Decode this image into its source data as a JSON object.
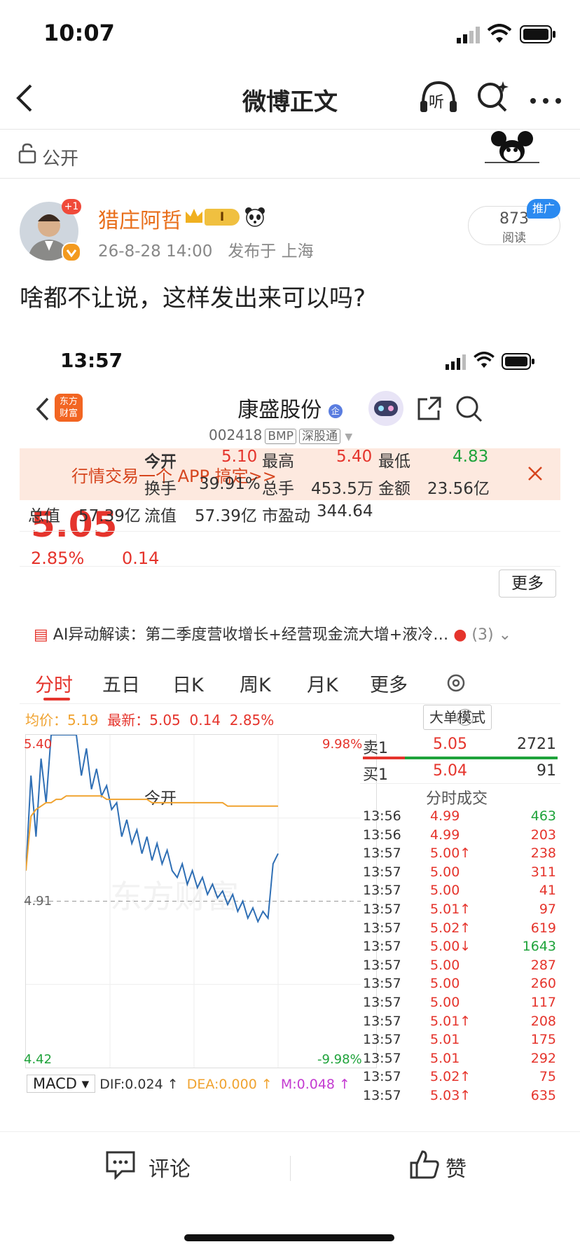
{
  "status_bar": {
    "time": "10:07"
  },
  "nav": {
    "title": "微博正文",
    "listen_label": "听"
  },
  "visibility": {
    "label": "公开"
  },
  "post": {
    "author": "猎庄阿哲",
    "avatar_badge": "+1",
    "vip_badge": "I",
    "date": "26-8-28 14:00",
    "location": "发布于 上海",
    "reads": "873",
    "reads_label": "阅读",
    "promo_label": "推广",
    "text": "啥都不让说，这样发出来可以吗?"
  },
  "embedded": {
    "time": "13:57",
    "app_logo": "东方财富",
    "stock_name": "康盛股份",
    "stock_code": "002418",
    "tags": [
      "BMP",
      "深股通"
    ],
    "banner": "行情交易一个 APP 搞定>>",
    "price": "5.05",
    "change_pct": "2.85%",
    "change_abs": "0.14",
    "stats": [
      {
        "label": "今开",
        "value": "5.10",
        "color": "red"
      },
      {
        "label": "最高",
        "value": "5.40",
        "color": "red"
      },
      {
        "label": "最低",
        "value": "4.83",
        "color": "green"
      },
      {
        "label": "换手",
        "value": "39.91%",
        "color": "black"
      },
      {
        "label": "总手",
        "value": "453.5万",
        "color": "black"
      },
      {
        "label": "金额",
        "value": "23.56亿",
        "color": "black"
      },
      {
        "label": "总值",
        "value": "57.39亿",
        "color": "black"
      },
      {
        "label": "流值",
        "value": "57.39亿",
        "color": "black"
      },
      {
        "label": "市盈动",
        "value": "344.64",
        "color": "black"
      }
    ],
    "more_label": "更多",
    "ai_label": "AI异动解读：",
    "ai_text": "第二季度营收增长+经营现金流大增+液冷…",
    "ai_count": "(3)",
    "tabs": [
      "分时",
      "五日",
      "日K",
      "周K",
      "月K",
      "更多"
    ],
    "avg_label": "均价：",
    "avg_value": "5.19",
    "latest_label": "最新：",
    "latest_value": "5.05",
    "latest_chg": "0.14",
    "latest_pct": "2.85%",
    "big_order_btn": "大单模式",
    "watermark": "东方财富",
    "macd": {
      "label": "MACD",
      "dif": "DIF:0.024 ↑",
      "dea": "DEA:0.000 ↑",
      "m": "M:0.048 ↑"
    },
    "orderbook": {
      "sell": {
        "label": "卖1",
        "price": "5.05",
        "vol": "2721"
      },
      "buy": {
        "label": "买1",
        "price": "5.04",
        "vol": "91"
      },
      "title": "分时成交",
      "trades": [
        {
          "t": "13:56",
          "p": "4.99",
          "v": "463",
          "pc": "red",
          "vc": "green"
        },
        {
          "t": "13:56",
          "p": "4.99",
          "v": "203",
          "pc": "red",
          "vc": "red"
        },
        {
          "t": "13:57",
          "p": "5.00↑",
          "v": "238",
          "pc": "red",
          "vc": "red"
        },
        {
          "t": "13:57",
          "p": "5.00",
          "v": "311",
          "pc": "red",
          "vc": "red"
        },
        {
          "t": "13:57",
          "p": "5.00",
          "v": "41",
          "pc": "red",
          "vc": "red"
        },
        {
          "t": "13:57",
          "p": "5.01↑",
          "v": "97",
          "pc": "red",
          "vc": "red"
        },
        {
          "t": "13:57",
          "p": "5.02↑",
          "v": "619",
          "pc": "red",
          "vc": "red"
        },
        {
          "t": "13:57",
          "p": "5.00↓",
          "v": "1643",
          "pc": "red",
          "vc": "green"
        },
        {
          "t": "13:57",
          "p": "5.00",
          "v": "287",
          "pc": "red",
          "vc": "red"
        },
        {
          "t": "13:57",
          "p": "5.00",
          "v": "260",
          "pc": "red",
          "vc": "red"
        },
        {
          "t": "13:57",
          "p": "5.00",
          "v": "117",
          "pc": "red",
          "vc": "red"
        },
        {
          "t": "13:57",
          "p": "5.01↑",
          "v": "208",
          "pc": "red",
          "vc": "red"
        },
        {
          "t": "13:57",
          "p": "5.01",
          "v": "175",
          "pc": "red",
          "vc": "red"
        },
        {
          "t": "13:57",
          "p": "5.01",
          "v": "292",
          "pc": "red",
          "vc": "red"
        },
        {
          "t": "13:57",
          "p": "5.02↑",
          "v": "75",
          "pc": "red",
          "vc": "red"
        },
        {
          "t": "13:57",
          "p": "5.03↑",
          "v": "635",
          "pc": "red",
          "vc": "red"
        }
      ]
    }
  },
  "chart_data": {
    "type": "line",
    "ylim": [
      4.42,
      5.4
    ],
    "ylim_pct": [
      "9.98%",
      "-9.98%"
    ],
    "prev_close": "4.91",
    "y_top_label": "5.40",
    "y_mid_label": "4.91",
    "y_bottom_label": "4.42",
    "series": [
      {
        "values": [
          5.0,
          5.28,
          5.1,
          5.33,
          5.2,
          5.4,
          5.4,
          5.4,
          5.4,
          5.4,
          5.4,
          5.28,
          5.36,
          5.24,
          5.3,
          5.22,
          5.25,
          5.18,
          5.2,
          5.1,
          5.15,
          5.08,
          5.12,
          5.05,
          5.1,
          5.03,
          5.08,
          5.02,
          5.06,
          5.0,
          4.98,
          5.02,
          4.96,
          5.0,
          4.95,
          4.98,
          4.93,
          4.96,
          4.92,
          4.94,
          4.9,
          4.93,
          4.88,
          4.91,
          4.86,
          4.89,
          4.85,
          4.88,
          4.86,
          5.02,
          5.05
        ]
      },
      {
        "values": [
          5.0,
          5.16,
          5.18,
          5.19,
          5.2,
          5.2,
          5.21,
          5.21,
          5.22,
          5.22,
          5.22,
          5.22,
          5.22,
          5.22,
          5.22,
          5.22,
          5.21,
          5.21,
          5.21,
          5.21,
          5.21,
          5.21,
          5.21,
          5.21,
          5.21,
          5.2,
          5.2,
          5.2,
          5.2,
          5.2,
          5.2,
          5.2,
          5.2,
          5.2,
          5.2,
          5.2,
          5.2,
          5.2,
          5.2,
          5.2,
          5.19,
          5.19,
          5.19,
          5.19,
          5.19,
          5.19,
          5.19,
          5.19,
          5.19,
          5.19,
          5.19
        ]
      }
    ]
  },
  "bottom": {
    "comment": "评论",
    "like": "赞"
  },
  "colors": {
    "accent": "#e5342c",
    "green": "#1fa33b",
    "orange": "#e86e1a",
    "blue_line": "#2f6fb5",
    "avg_line": "#f0a330"
  }
}
